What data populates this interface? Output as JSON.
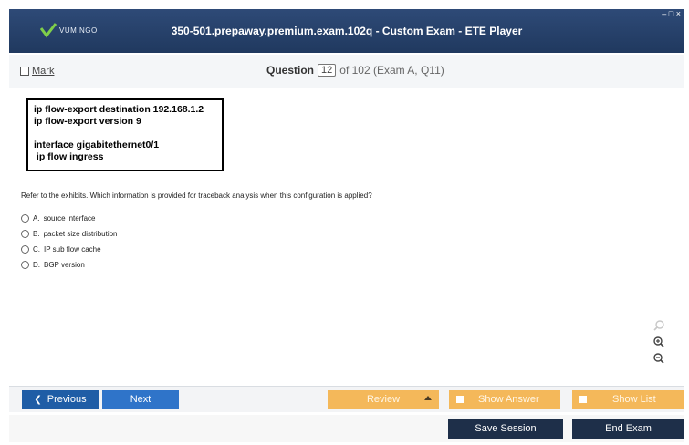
{
  "window": {
    "title": "350-501.prepaway.premium.exam.102q - Custom Exam - ETE Player",
    "logo_text": "VUMINGO",
    "controls": "– □ ×"
  },
  "question_bar": {
    "mark_label": "Mark",
    "question_label": "Question",
    "question_number": "12",
    "of_text": "of 102 (Exam A, Q11)"
  },
  "exhibit": {
    "lines": [
      "ip flow-export destination 192.168.1.2",
      "ip flow-export version 9",
      "",
      "interface gigabitethernet0/1",
      " ip flow ingress"
    ]
  },
  "question_text": "Refer to the exhibits. Which information is provided for traceback analysis when this configuration is applied?",
  "options": [
    {
      "letter": "A.",
      "text": "source interface"
    },
    {
      "letter": "B.",
      "text": "packet size distribution"
    },
    {
      "letter": "C.",
      "text": "IP sub flow cache"
    },
    {
      "letter": "D.",
      "text": "BGP version"
    }
  ],
  "nav": {
    "previous": "Previous",
    "next": "Next",
    "review": "Review",
    "show_answer": "Show Answer",
    "show_list": "Show List"
  },
  "bottom": {
    "save_session": "Save Session",
    "end_exam": "End Exam"
  },
  "colors": {
    "titlebar": "#20395f",
    "nav_blue": "#2f74c9",
    "accent_orange": "#f4b85a",
    "dark_button": "#1e2f49"
  },
  "icons": [
    "search-icon",
    "zoom-in-icon",
    "zoom-out-icon"
  ]
}
